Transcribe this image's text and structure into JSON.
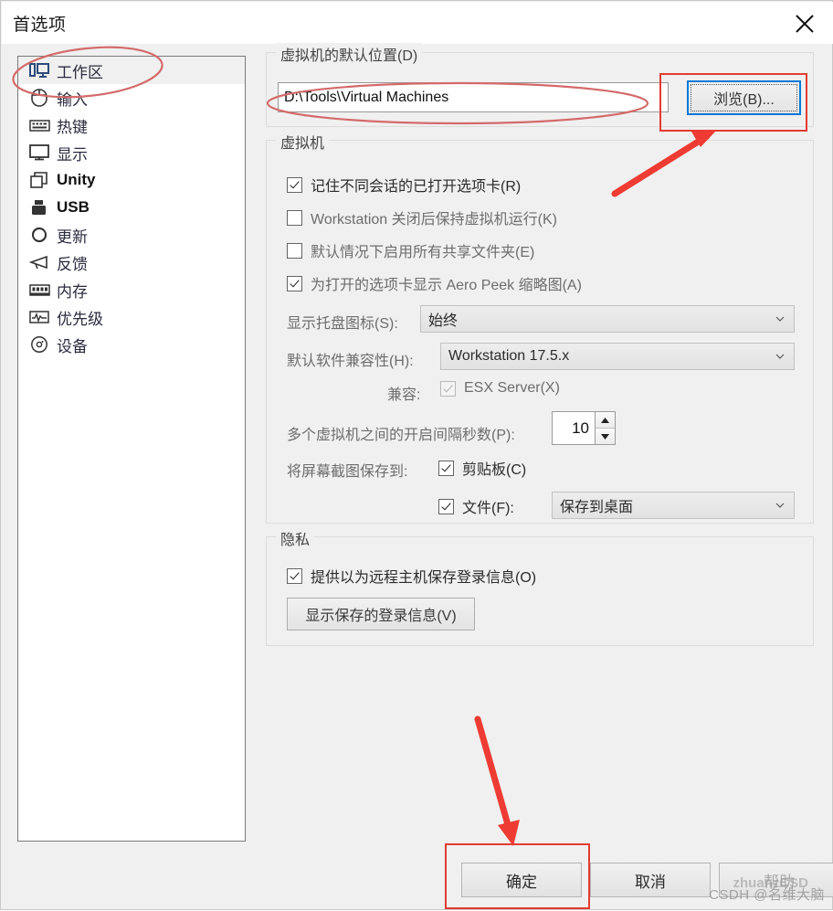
{
  "window": {
    "title": "首选项",
    "close_label": "×"
  },
  "sidebar": {
    "items": [
      {
        "label": "工作区",
        "icon": "workspace-icon",
        "selected": true
      },
      {
        "label": "输入",
        "icon": "mouse-icon",
        "selected": false
      },
      {
        "label": "热键",
        "icon": "keyboard-icon",
        "selected": false
      },
      {
        "label": "显示",
        "icon": "monitor-icon",
        "selected": false
      },
      {
        "label": "Unity",
        "icon": "unity-icon",
        "selected": false,
        "latin": true
      },
      {
        "label": "USB",
        "icon": "usb-icon",
        "selected": false,
        "latin": true
      },
      {
        "label": "更新",
        "icon": "refresh-icon",
        "selected": false
      },
      {
        "label": "反馈",
        "icon": "megaphone-icon",
        "selected": false
      },
      {
        "label": "内存",
        "icon": "memory-icon",
        "selected": false
      },
      {
        "label": "优先级",
        "icon": "chart-icon",
        "selected": false
      },
      {
        "label": "设备",
        "icon": "disc-icon",
        "selected": false
      }
    ]
  },
  "default_location": {
    "group_title": "虚拟机的默认位置(D)",
    "path_value": "D:\\Tools\\Virtual Machines",
    "browse_label": "浏览(B)..."
  },
  "virtual_machine": {
    "group_title": "虚拟机",
    "checkboxes": [
      {
        "label": "记住不同会话的已打开选项卡(R)",
        "checked": true,
        "style": "dark"
      },
      {
        "label": "Workstation 关闭后保持虚拟机运行(K)",
        "checked": false,
        "style": "mix",
        "bold_prefix": "Workstation"
      },
      {
        "label": "默认情况下启用所有共享文件夹(E)",
        "checked": false,
        "style": "grey"
      },
      {
        "label": "为打开的选项卡显示 Aero Peek 缩略图(A)",
        "checked": true,
        "style": "mix2",
        "bold_part": "Aero Peek"
      }
    ],
    "tray_icon_label": "显示托盘图标(S):",
    "tray_icon_value": "始终",
    "compat_label": "默认软件兼容性(H):",
    "compat_value": "Workstation 17.5.x",
    "esx_label": "兼容:",
    "esx_checkbox_label": "ESX Server(X)",
    "esx_checked": true,
    "esx_disabled": true,
    "interval_label": "多个虚拟机之间的开启间隔秒数(P):",
    "interval_value": "10",
    "screenshot_label": "将屏幕截图保存到:",
    "clipboard_label": "剪贴板(C)",
    "clipboard_checked": true,
    "file_label": "文件(F):",
    "file_checked": true,
    "file_target_value": "保存到桌面"
  },
  "privacy": {
    "group_title": "隐私",
    "checkbox_label": "提供以为远程主机保存登录信息(O)",
    "checkbox_checked": true,
    "button_label": "显示保存的登录信息(V)"
  },
  "footer": {
    "ok_label": "确定",
    "cancel_label": "取消",
    "help_label": "帮助"
  },
  "watermark": {
    "text": "CSDH @名维大脑",
    "text2": "zhuanzCSD"
  },
  "annotations": {
    "accent_color": "#ee3b33",
    "ellipse_color": "#d46a6a"
  }
}
